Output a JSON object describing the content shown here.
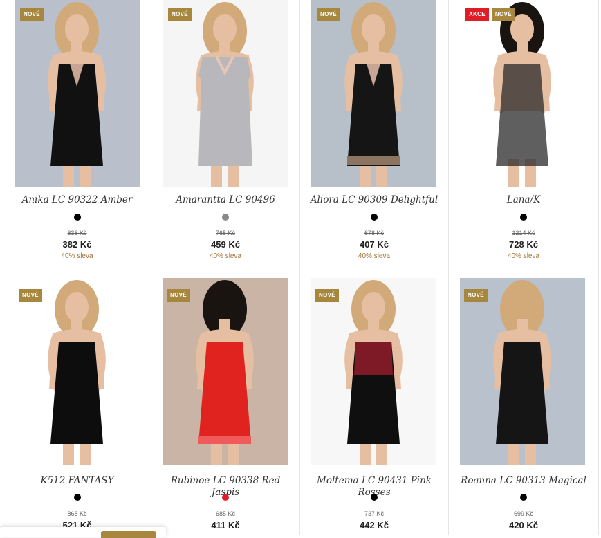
{
  "products": [
    {
      "name": "Anika LC 90322 Amber",
      "badges": [
        "NOVÉ"
      ],
      "old_price": "636 Kč",
      "price": "382 Kč",
      "discount": "40% sleva",
      "color": "black",
      "image": "black-lace-chemise"
    },
    {
      "name": "Amarantta LC 90496",
      "badges": [
        "NOVÉ"
      ],
      "old_price": "765 Kč",
      "price": "459 Kč",
      "discount": "40% sleva",
      "color": "gray",
      "image": "gray-nightshirt"
    },
    {
      "name": "Aliora LC 90309 Delightful",
      "badges": [
        "NOVÉ"
      ],
      "old_price": "678 Kč",
      "price": "407 Kč",
      "discount": "40% sleva",
      "color": "black",
      "image": "black-mesh-chemise"
    },
    {
      "name": "Lana/K",
      "badges": [
        "AKCE",
        "NOVÉ"
      ],
      "old_price": "1214 Kč",
      "price": "728 Kč",
      "discount": "40% sleva",
      "color": "black",
      "image": "sheer-dotted-babydoll"
    },
    {
      "name": "K512 FANTASY",
      "badges": [
        "NOVÉ"
      ],
      "old_price": "868 Kč",
      "price": "521 Kč",
      "discount": "",
      "color": "black",
      "image": "black-satin-nightgown"
    },
    {
      "name": "Rubinoe LC 90338 Red Jaspis",
      "badges": [
        "NOVÉ"
      ],
      "old_price": "685 Kč",
      "price": "411 Kč",
      "discount": "",
      "color": "red",
      "image": "red-satin-chemise"
    },
    {
      "name": "Moltema LC 90431 Pink Rosses",
      "badges": [
        "NOVÉ"
      ],
      "old_price": "737 Kč",
      "price": "442 Kč",
      "discount": "",
      "color": "black",
      "image": "black-burgundy-chemise"
    },
    {
      "name": "Roanna LC 90313 Magical",
      "badges": [
        "NOVÉ"
      ],
      "old_price": "699 Kč",
      "price": "420 Kč",
      "discount": "",
      "color": "black",
      "image": "black-laceup-dress"
    }
  ],
  "colors": {
    "badge_new": "#a7873d",
    "badge_sale": "#e01d26",
    "discount": "#a0743d"
  }
}
